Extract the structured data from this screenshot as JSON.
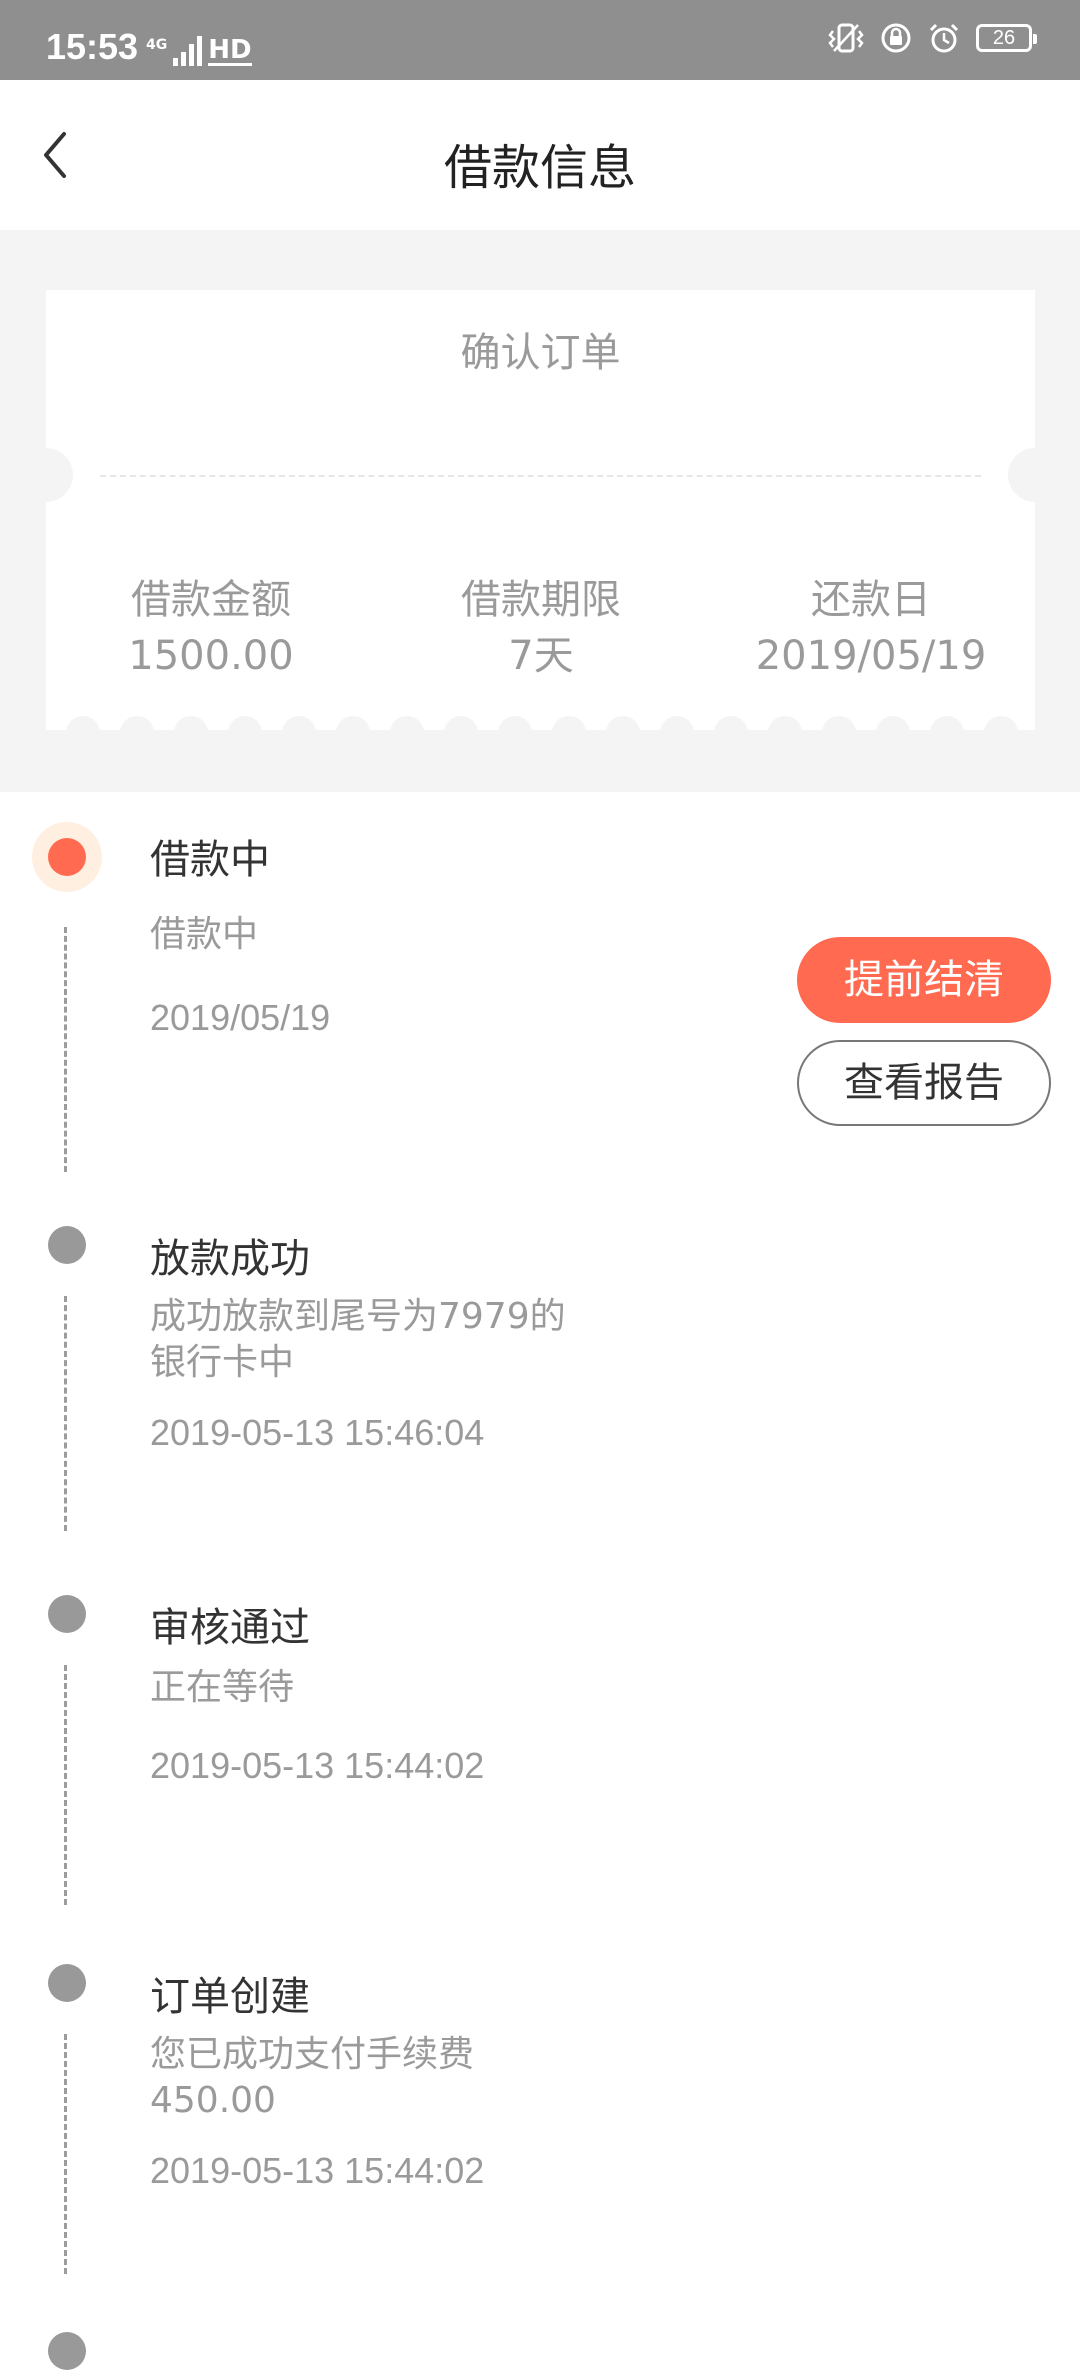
{
  "status_bar": {
    "time": "15:53",
    "network": "4G",
    "hd": "HD",
    "battery": "26",
    "icons": [
      "vibrate-icon",
      "lock-rotation-icon",
      "alarm-icon",
      "battery-icon"
    ]
  },
  "header": {
    "title": "借款信息",
    "back_icon": "back-chevron-icon"
  },
  "ticket": {
    "header": "确认订单",
    "items": [
      {
        "label": "借款金额",
        "value": "1500.00"
      },
      {
        "label": "借款期限",
        "value": "7天"
      },
      {
        "label": "还款日",
        "value": "2019/05/19"
      }
    ]
  },
  "timeline": [
    {
      "title": "借款中",
      "desc": "借款中",
      "time": "2019/05/19",
      "active": true
    },
    {
      "title": "放款成功",
      "desc": "成功放款到尾号为7979的银行卡中",
      "time": "2019-05-13 15:46:04",
      "active": false
    },
    {
      "title": "审核通过",
      "desc": "正在等待",
      "time": "2019-05-13 15:44:02",
      "active": false
    },
    {
      "title": "订单创建",
      "desc": "您已成功支付手续费450.00",
      "time": "2019-05-13 15:44:02",
      "active": false
    }
  ],
  "actions": {
    "settle_label": "提前结清",
    "report_label": "查看报告"
  },
  "colors": {
    "accent": "#ff6a50",
    "accent_halo": "#ffefe0",
    "inactive_dot": "#999999",
    "status_bar": "#8f8f8f"
  }
}
